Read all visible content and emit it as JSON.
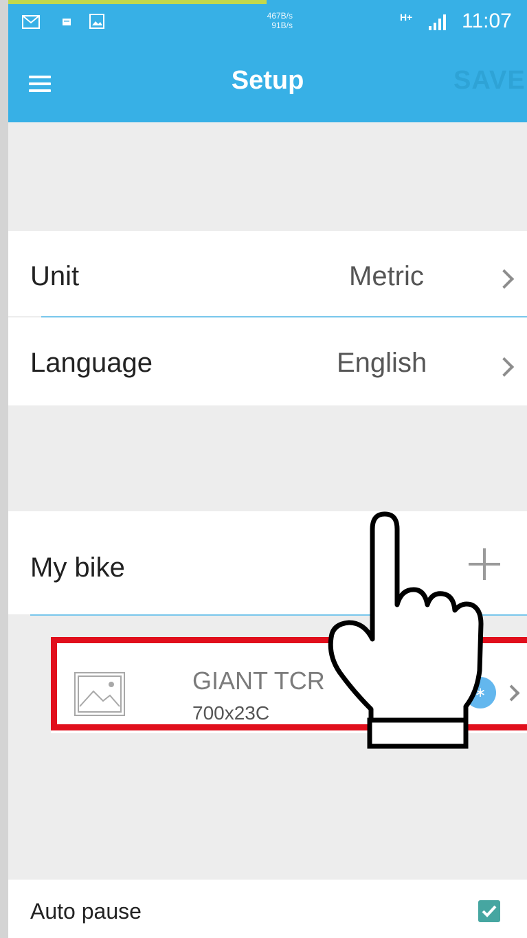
{
  "status_bar": {
    "net_down": "467B/s",
    "net_up": "91B/s",
    "network_type": "H+",
    "time": "11:07"
  },
  "app_bar": {
    "title": "Setup",
    "save_label": "SAVE"
  },
  "settings": {
    "unit": {
      "label": "Unit",
      "value": "Metric"
    },
    "language": {
      "label": "Language",
      "value": "English"
    }
  },
  "my_bike": {
    "header": "My bike",
    "add_icon": "plus-icon",
    "bike": {
      "name": "GIANT TCR",
      "size": "700x23C",
      "connection_icon": "bluetooth-icon"
    }
  },
  "auto_pause": {
    "label": "Auto pause",
    "checked": true
  },
  "colors": {
    "accent": "#37b0e6",
    "highlight": "#e10f1c",
    "checkbox": "#46a6a1"
  }
}
